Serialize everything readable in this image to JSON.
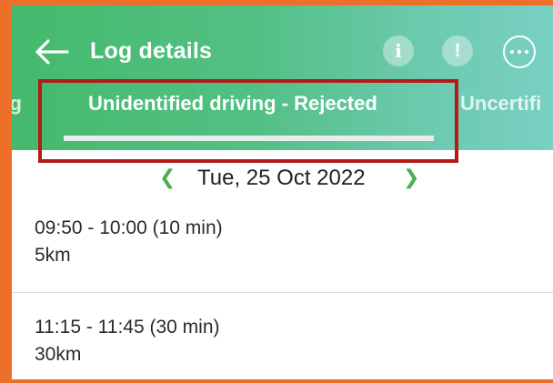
{
  "header": {
    "title": "Log details",
    "info_icon_glyph": "i",
    "warning_icon_glyph": "!",
    "colors": {
      "gradient_start": "#44ba6c",
      "gradient_end": "#78d0c3"
    }
  },
  "tabs": [
    {
      "label": "og",
      "state": "partial"
    },
    {
      "label": "Unidentified driving - Rejected",
      "state": "active"
    },
    {
      "label": "Uncertifi",
      "state": "partial"
    }
  ],
  "date_nav": {
    "date": "Tue, 25 Oct 2022"
  },
  "entries": [
    {
      "time": "09:50 - 10:00 (10 min)",
      "distance": "5km"
    },
    {
      "time": "11:15 - 11:45 (30 min)",
      "distance": "30km"
    }
  ],
  "annotation": {
    "color": "#b51a1a",
    "frame_color": "#ee6f2a"
  }
}
